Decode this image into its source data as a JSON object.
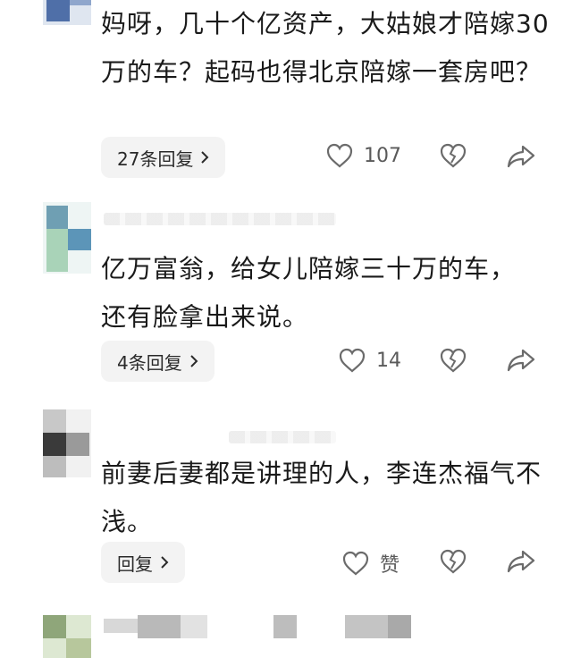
{
  "comments": [
    {
      "text": "妈呀，几十个亿资产，大姑娘才陪嫁30万的车？起码也得北京陪嫁一套房吧？",
      "reply_label": "27条回复",
      "like_count": "107"
    },
    {
      "text": "亿万富翁，给女儿陪嫁三十万的车，还有脸拿出来说。",
      "reply_label": "4条回复",
      "like_count": "14"
    },
    {
      "text": "前妻后妻都是讲理的人，李连杰福气不浅。",
      "reply_label": "回复",
      "like_count": "赞"
    }
  ],
  "icons": {
    "like": "heart-icon",
    "dislike": "broken-heart-icon",
    "share": "share-icon",
    "reply_chevron": "chevron-right-icon"
  },
  "colors": {
    "text": "#1a1a1a",
    "reply_bg": "#f3f3f3",
    "icon": "#6b6b6b"
  }
}
